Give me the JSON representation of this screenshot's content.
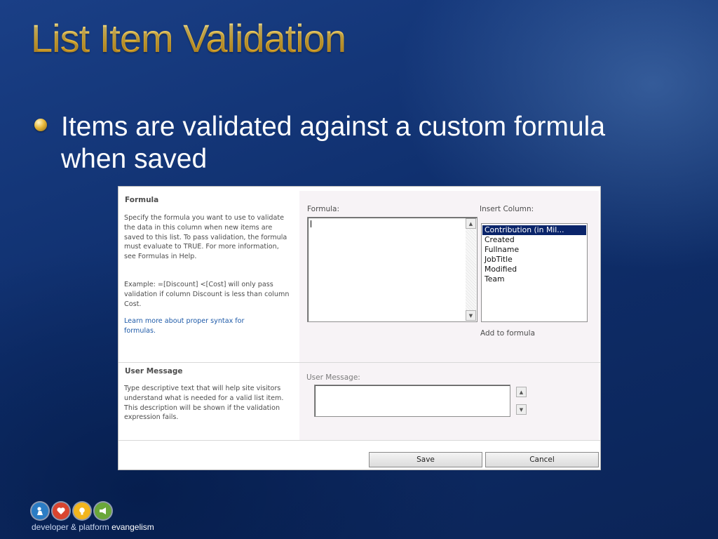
{
  "slide": {
    "title": "List Item Validation",
    "bullet": "Items are validated against a custom formula when saved"
  },
  "formula_section": {
    "title": "Formula",
    "description": "Specify the formula you want to use to validate the data in this column when new items are saved to this list. To pass validation, the formula must evaluate to TRUE. For more information, see Formulas in Help.",
    "example": "Example: =[Discount] <[Cost] will only pass validation if column Discount is less than column Cost.",
    "link": "Learn more about proper syntax for formulas.",
    "formula_label": "Formula:",
    "formula_value": "",
    "insert_column_label": "Insert Column:",
    "columns": [
      "Contribution (in Mil...",
      "Created",
      "Fullname",
      "JobTitle",
      "Modified",
      "Team"
    ],
    "selected_column": "Contribution (in Mil...",
    "add_to_formula": "Add to formula"
  },
  "message_section": {
    "title": "User Message",
    "description": "Type descriptive text that will help site visitors understand what is needed for a valid list item. This description will be shown if the validation expression fails.",
    "user_message_label": "User Message:",
    "user_message_value": ""
  },
  "buttons": {
    "save": "Save",
    "cancel": "Cancel"
  },
  "footer": {
    "text_regular": "developer & platform",
    "text_bold": "evangelism"
  },
  "colors": {
    "title_gold": "#f5c042",
    "selection_blue": "#0a246a",
    "link_blue": "#1e5aa8",
    "logo_blue": "#2b7cc4",
    "logo_red": "#d9452f",
    "logo_yellow": "#f2b51d",
    "logo_green": "#6aa73a"
  },
  "icons": {
    "bullet": "gold-bullet-icon",
    "scroll_up": "scroll-up-arrow-icon",
    "scroll_down": "scroll-down-arrow-icon",
    "logos": [
      "person-icon",
      "heart-icon",
      "lightbulb-icon",
      "megaphone-icon"
    ]
  }
}
